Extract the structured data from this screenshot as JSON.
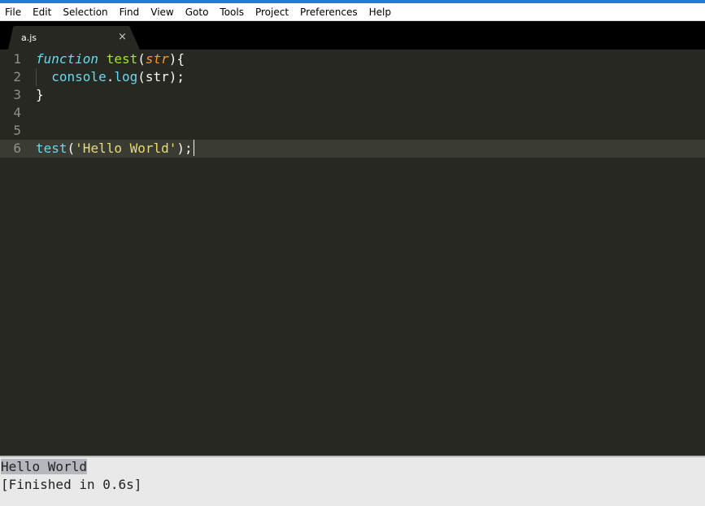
{
  "window": {
    "accent_color": "#1e7bd6"
  },
  "menubar": {
    "items": [
      "File",
      "Edit",
      "Selection",
      "Find",
      "View",
      "Goto",
      "Tools",
      "Project",
      "Preferences",
      "Help"
    ]
  },
  "tabs": [
    {
      "label": "a.js",
      "close_glyph": "×",
      "active": true,
      "icon": "close-icon"
    }
  ],
  "editor": {
    "theme_background": "#272822",
    "lines": [
      {
        "number": "1",
        "tokens": [
          {
            "text": "function",
            "kind": "storage"
          },
          {
            "text": " ",
            "kind": "plain"
          },
          {
            "text": "test",
            "kind": "function-name"
          },
          {
            "text": "(",
            "kind": "plain"
          },
          {
            "text": "str",
            "kind": "parameter"
          },
          {
            "text": "){",
            "kind": "plain"
          }
        ]
      },
      {
        "number": "2",
        "tokens": [
          {
            "text": "  ",
            "kind": "plain"
          },
          {
            "text": "console",
            "kind": "support"
          },
          {
            "text": ".",
            "kind": "plain"
          },
          {
            "text": "log",
            "kind": "method"
          },
          {
            "text": "(str);",
            "kind": "plain"
          }
        ]
      },
      {
        "number": "3",
        "tokens": [
          {
            "text": "}",
            "kind": "plain"
          }
        ]
      },
      {
        "number": "4",
        "tokens": []
      },
      {
        "number": "5",
        "tokens": []
      },
      {
        "number": "6",
        "current": true,
        "tokens": [
          {
            "text": "test",
            "kind": "method"
          },
          {
            "text": "(",
            "kind": "plain"
          },
          {
            "text": "'Hello World'",
            "kind": "string"
          },
          {
            "text": ");",
            "kind": "plain"
          }
        ]
      }
    ]
  },
  "output": {
    "lines": [
      {
        "text": "Hello World",
        "selected": true
      },
      {
        "text": "[Finished in 0.6s]",
        "selected": false
      }
    ]
  }
}
